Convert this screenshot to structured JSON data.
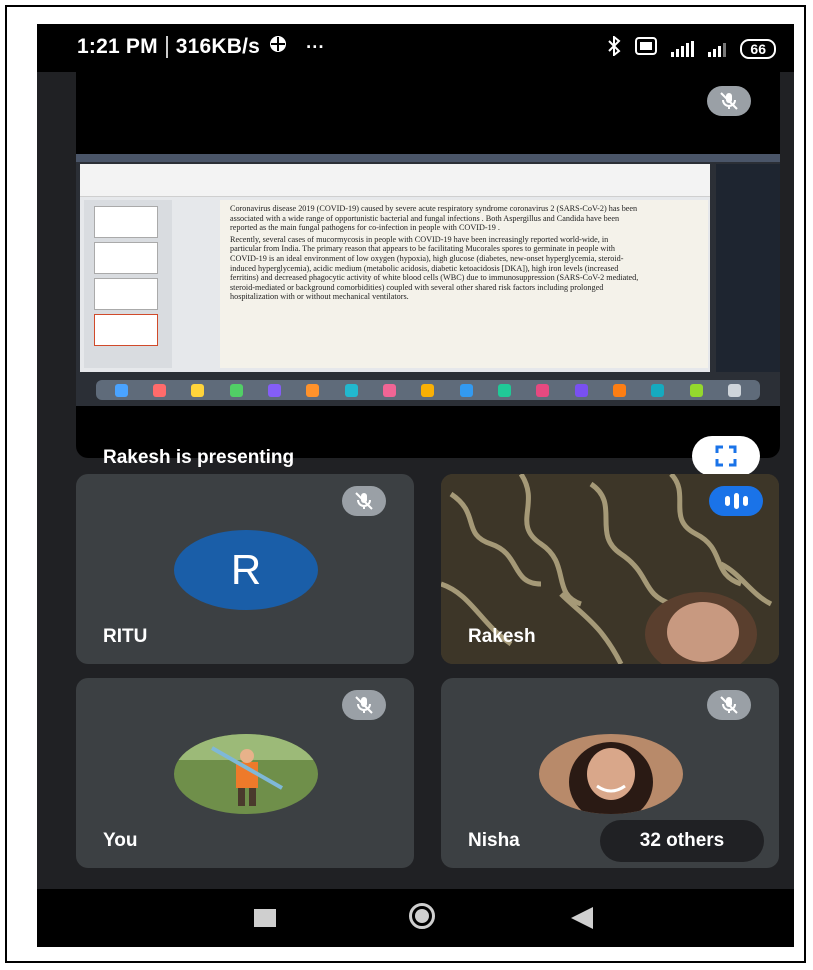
{
  "status_bar": {
    "time": "1:21 PM",
    "speed": "316KB/s",
    "dots": "···",
    "battery": "66"
  },
  "presentation": {
    "label": "Rakesh is presenting",
    "slide": {
      "bullets": [
        "Coronavirus disease 2019 (COVID-19) caused by severe acute respiratory syndrome coronavirus 2 (SARS-CoV-2) has been associated with a wide range of opportunistic bacterial and fungal infections . Both Aspergillus and Candida have been reported as the main fungal pathogens for co-infection in people with COVID-19 .",
        "Recently, several cases of mucormycosis in people with COVID-19 have been increasingly reported world-wide, in particular from India. The primary reason that appears to be facilitating Mucorales spores to germinate in people with COVID-19 is an ideal environment of low oxygen (hypoxia), high glucose (diabetes, new-onset hyperglycemia, steroid-induced hyperglycemia), acidic medium (metabolic acidosis, diabetic ketoacidosis [DKA]), high iron levels (increased ferritins) and decreased phagocytic activity of white blood cells (WBC) due to immunosuppression (SARS-CoV-2 mediated, steroid-mediated or background comorbidities) coupled with several other shared risk factors including prolonged hospitalization with or without mechanical ventilators."
      ]
    }
  },
  "participants": [
    {
      "name": "RITU",
      "initial": "R",
      "muted": true
    },
    {
      "name": "Rakesh",
      "speaking": true
    },
    {
      "name": "You",
      "muted": true
    },
    {
      "name": "Nisha",
      "muted": true,
      "others_label": "32 others"
    }
  ],
  "colors": {
    "background": "#202124",
    "tile": "#3c4043",
    "avatar_blue": "#1a5ea8",
    "speaking_blue": "#1a73e8",
    "mic_badge": "#9aa0a6"
  },
  "icons": [
    "bluetooth-icon",
    "volte-icon",
    "signal-icon",
    "battery-icon",
    "mic-off-icon",
    "fullscreen-icon",
    "voice-activity-icon",
    "nav-recents-icon",
    "nav-home-icon",
    "nav-back-icon"
  ]
}
